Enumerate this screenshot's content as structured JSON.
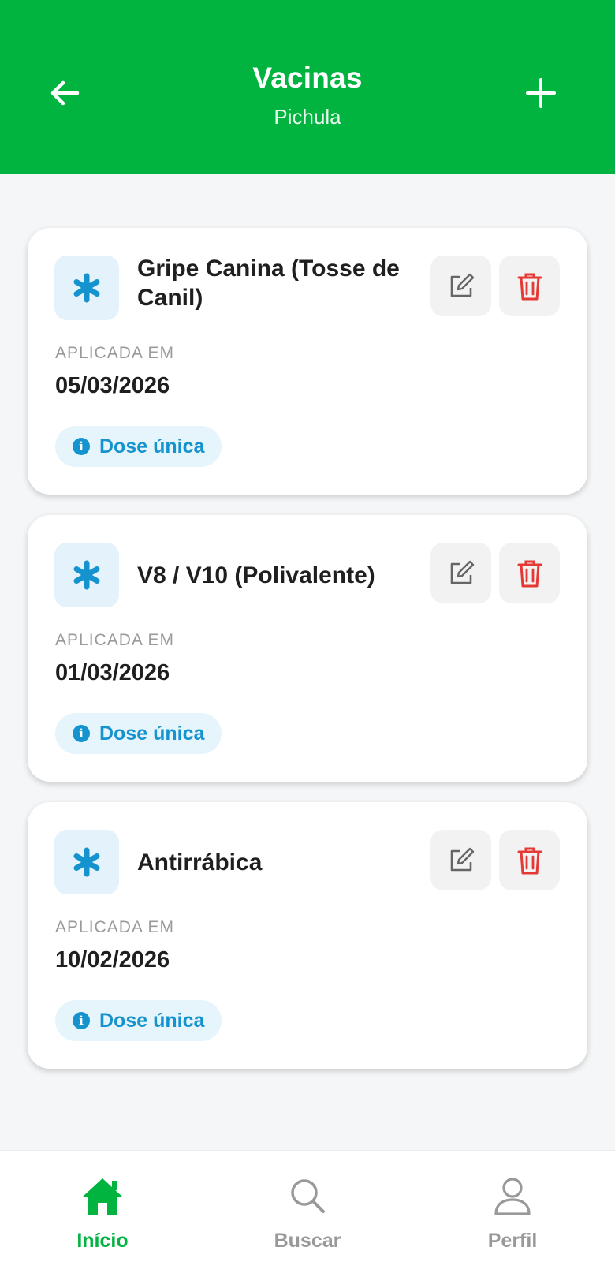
{
  "header": {
    "title": "Vacinas",
    "subtitle": "Pichula",
    "back_icon": "arrow-left-icon",
    "add_icon": "plus-icon",
    "background": "#00b43f"
  },
  "vaccines": [
    {
      "name": "Gripe Canina (Tosse de Canil)",
      "applied_label": "APLICADA EM",
      "date": "05/03/2026",
      "badge": "Dose única"
    },
    {
      "name": "V8 / V10 (Polivalente)",
      "applied_label": "APLICADA EM",
      "date": "01/03/2026",
      "badge": "Dose única"
    },
    {
      "name": "Antirrábica",
      "applied_label": "APLICADA EM",
      "date": "10/02/2026",
      "badge": "Dose única"
    }
  ],
  "card_icons": {
    "vaccine": "asterisk-icon",
    "edit": "edit-icon",
    "delete": "trash-icon",
    "info": "info-icon"
  },
  "nav": {
    "items": [
      {
        "label": "Início",
        "icon": "home-icon",
        "active": true
      },
      {
        "label": "Buscar",
        "icon": "search-icon",
        "active": false
      },
      {
        "label": "Perfil",
        "icon": "user-icon",
        "active": false
      }
    ]
  },
  "colors": {
    "accent": "#00b43f",
    "info_blue": "#1593cf",
    "delete_red": "#e53935"
  }
}
